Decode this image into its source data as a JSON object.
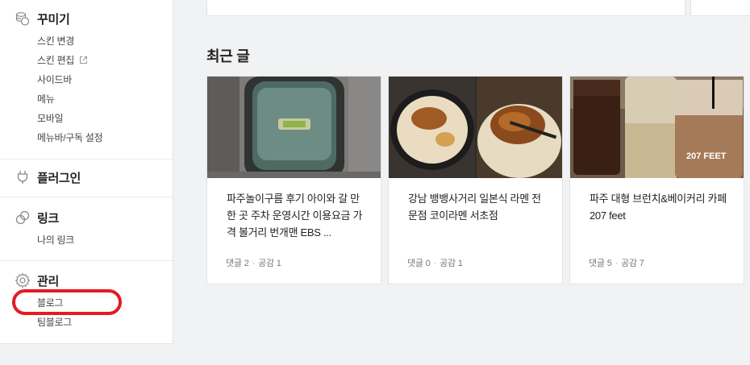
{
  "sidebar": {
    "sections": [
      {
        "title": "꾸미기",
        "icon": "coins-icon",
        "items": [
          "스킨 변경",
          "스킨 편집",
          "사이드바",
          "메뉴",
          "모바일",
          "메뉴바/구독 설정"
        ]
      },
      {
        "title": "플러그인",
        "icon": "plug-icon",
        "items": []
      },
      {
        "title": "링크",
        "icon": "link-icon",
        "items": [
          "나의 링크"
        ]
      },
      {
        "title": "관리",
        "icon": "gear-icon",
        "items": [
          "블로그",
          "팀블로그"
        ]
      }
    ]
  },
  "highlight_color": "#e41b23",
  "recent": {
    "title": "최근 글",
    "posts": [
      {
        "title": "파주놀이구름 후기 아이와 갈 만한 곳 주차 운영시간 이용요금 가격 볼거리 번개맨 EBS ...",
        "comment_label": "댓글 2",
        "like_label": "공감 1"
      },
      {
        "title": "강남 뱅뱅사거리 일본식 라멘 전문점 코이라멘 서초점",
        "comment_label": "댓글 0",
        "like_label": "공감 1"
      },
      {
        "title": "파주 대형 브런치&베이커리 카페 207 feet",
        "comment_label": "댓글 5",
        "like_label": "공감 7"
      }
    ]
  }
}
